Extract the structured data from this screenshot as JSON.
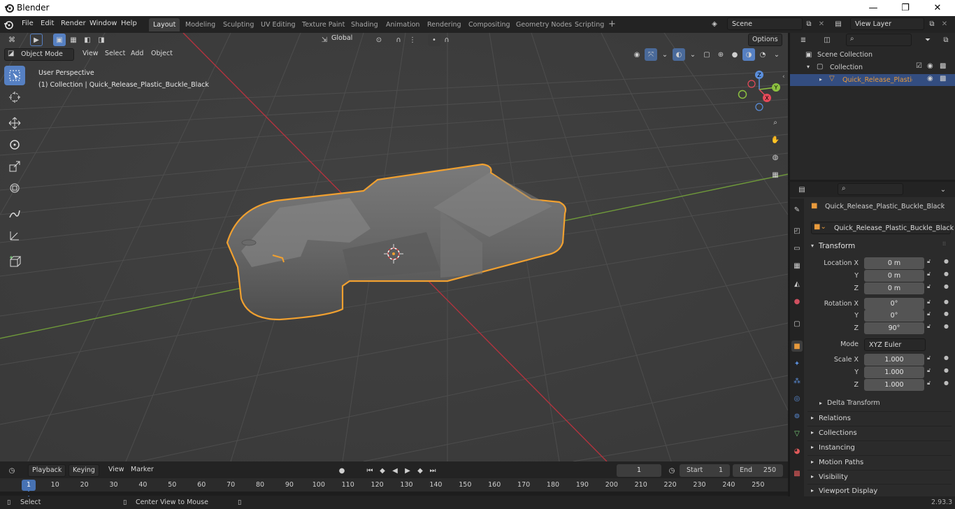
{
  "window": {
    "title": "Blender",
    "minimize_glyph": "—",
    "maximize_glyph": "❐",
    "close_glyph": "✕"
  },
  "menu": [
    "File",
    "Edit",
    "Render",
    "Window",
    "Help"
  ],
  "workspaces": [
    "Layout",
    "Modeling",
    "Sculpting",
    "UV Editing",
    "Texture Paint",
    "Shading",
    "Animation",
    "Rendering",
    "Compositing",
    "Geometry Nodes",
    "Scripting"
  ],
  "workspace_add": "+",
  "scene": {
    "name": "Scene",
    "view_layer": "View Layer"
  },
  "viewport": {
    "mode": "Object Mode",
    "header_menus": [
      "View",
      "Select",
      "Add",
      "Object"
    ],
    "transform_orientation": "Global",
    "options_label": "Options",
    "perspective_label": "User Perspective",
    "collection_label": "(1) Collection | Quick_Release_Plastic_Buckle_Black",
    "gizmo_axes": {
      "x": "X",
      "y": "Y",
      "z": "Z"
    }
  },
  "outliner": {
    "scene_collection": "Scene Collection",
    "collection": "Collection",
    "object": "Quick_Release_Plastic_B"
  },
  "properties": {
    "object_name": "Quick_Release_Plastic_Buckle_Black",
    "data_name": "Quick_Release_Plastic_Buckle_Black",
    "transform_title": "Transform",
    "location_label": "Location X",
    "y_label": "Y",
    "z_label": "Z",
    "location": {
      "x": "0 m",
      "y": "0 m",
      "z": "0 m"
    },
    "rotation_label": "Rotation X",
    "rotation": {
      "x": "0°",
      "y": "0°",
      "z": "90°"
    },
    "mode_label": "Mode",
    "mode_value": "XYZ Euler",
    "scale_label": "Scale X",
    "scale": {
      "x": "1.000",
      "y": "1.000",
      "z": "1.000"
    },
    "delta_transform": "Delta Transform",
    "panels": [
      "Relations",
      "Collections",
      "Instancing",
      "Motion Paths",
      "Visibility",
      "Viewport Display"
    ]
  },
  "timeline": {
    "menus": [
      "Playback",
      "Keying",
      "View",
      "Marker"
    ],
    "current_frame": "1",
    "start_label": "Start",
    "start": "1",
    "end_label": "End",
    "end": "250",
    "ruler_current": "1",
    "ticks": [
      "10",
      "20",
      "30",
      "40",
      "50",
      "60",
      "70",
      "80",
      "90",
      "100",
      "110",
      "120",
      "130",
      "140",
      "150",
      "160",
      "170",
      "180",
      "190",
      "200",
      "210",
      "220",
      "230",
      "240",
      "250"
    ]
  },
  "status": {
    "select": "Select",
    "center_view": "Center View to Mouse",
    "version": "2.93.3"
  },
  "colors": {
    "accent": "#5680c2",
    "selection_outline": "#f0a030",
    "x_axis": "#c8303c",
    "y_axis": "#7aa63a",
    "active_object": "#e89a3c"
  }
}
